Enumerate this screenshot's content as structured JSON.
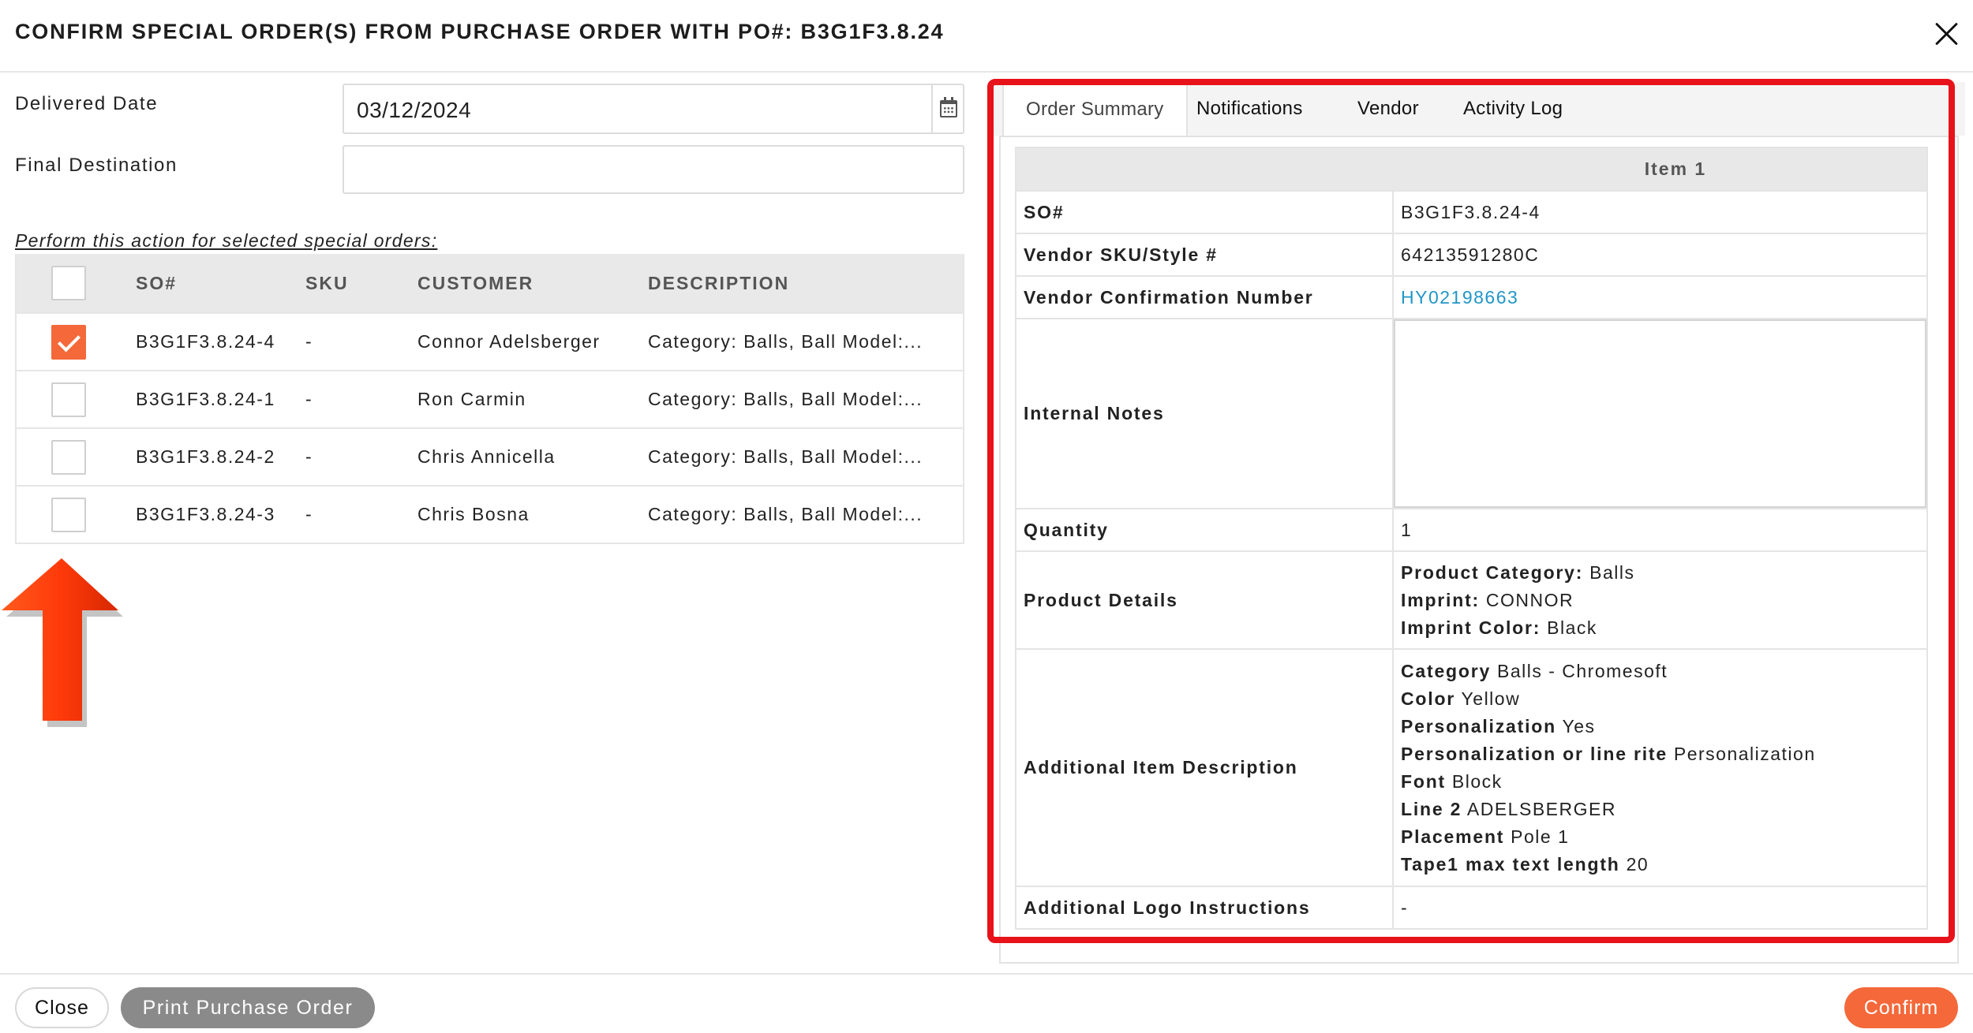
{
  "header": {
    "title": "CONFIRM SPECIAL ORDER(S) FROM PURCHASE ORDER WITH PO#: B3G1F3.8.24",
    "close_icon": "close-icon"
  },
  "form": {
    "delivered_label": "Delivered Date",
    "delivered_value": "03/12/2024",
    "final_label": "Final Destination",
    "final_value": "",
    "perform_text": "Perform this action for selected special orders:"
  },
  "orders": {
    "columns": {
      "so": "SO#",
      "sku": "SKU",
      "customer": "CUSTOMER",
      "description": "DESCRIPTION"
    },
    "rows": [
      {
        "checked": true,
        "so": "B3G1F3.8.24-4",
        "sku": "-",
        "customer": "Connor Adelsberger",
        "description": "Category: Balls, Ball Model:..."
      },
      {
        "checked": false,
        "so": "B3G1F3.8.24-1",
        "sku": "-",
        "customer": "Ron Carmin",
        "description": "Category: Balls, Ball Model:..."
      },
      {
        "checked": false,
        "so": "B3G1F3.8.24-2",
        "sku": "-",
        "customer": "Chris Annicella",
        "description": "Category: Balls, Ball Model:..."
      },
      {
        "checked": false,
        "so": "B3G1F3.8.24-3",
        "sku": "-",
        "customer": "Chris Bosna",
        "description": "Category: Balls, Ball Model:..."
      }
    ]
  },
  "tabs": {
    "order_summary": "Order Summary",
    "notifications": "Notifications",
    "vendor": "Vendor",
    "activity_log": "Activity Log"
  },
  "summary": {
    "item_header": "Item 1",
    "so_label": "SO#",
    "so_value": "B3G1F3.8.24-4",
    "vendor_sku_label": "Vendor SKU/Style #",
    "vendor_sku_value": "64213591280C",
    "vendor_conf_label": "Vendor Confirmation Number",
    "vendor_conf_value": "HY02198663",
    "internal_notes_label": "Internal Notes",
    "internal_notes_value": "",
    "quantity_label": "Quantity",
    "quantity_value": "1",
    "product_details_label": "Product Details",
    "product_details": [
      {
        "key": "Product Category:",
        "value": "Balls"
      },
      {
        "key": "Imprint:",
        "value": "CONNOR"
      },
      {
        "key": "Imprint Color:",
        "value": "Black"
      }
    ],
    "additional_desc_label": "Additional Item Description",
    "additional_desc": [
      {
        "key": "Category",
        "value": "Balls - Chromesoft"
      },
      {
        "key": "Color",
        "value": "Yellow"
      },
      {
        "key": "Personalization",
        "value": "Yes"
      },
      {
        "key": "Personalization or line rite",
        "value": "Personalization"
      },
      {
        "key": "Font",
        "value": "Block"
      },
      {
        "key": "Line 2",
        "value": "ADELSBERGER"
      },
      {
        "key": "Placement",
        "value": "Pole 1"
      },
      {
        "key": "Tape1 max text length",
        "value": "20"
      }
    ],
    "logo_label": "Additional Logo Instructions",
    "logo_value": "-"
  },
  "footer": {
    "close_label": "Close",
    "print_label": "Print Purchase Order",
    "confirm_label": "Confirm"
  },
  "colors": {
    "accent": "#f4683a",
    "highlight_frame": "#e8121a",
    "link": "#2196c8"
  }
}
